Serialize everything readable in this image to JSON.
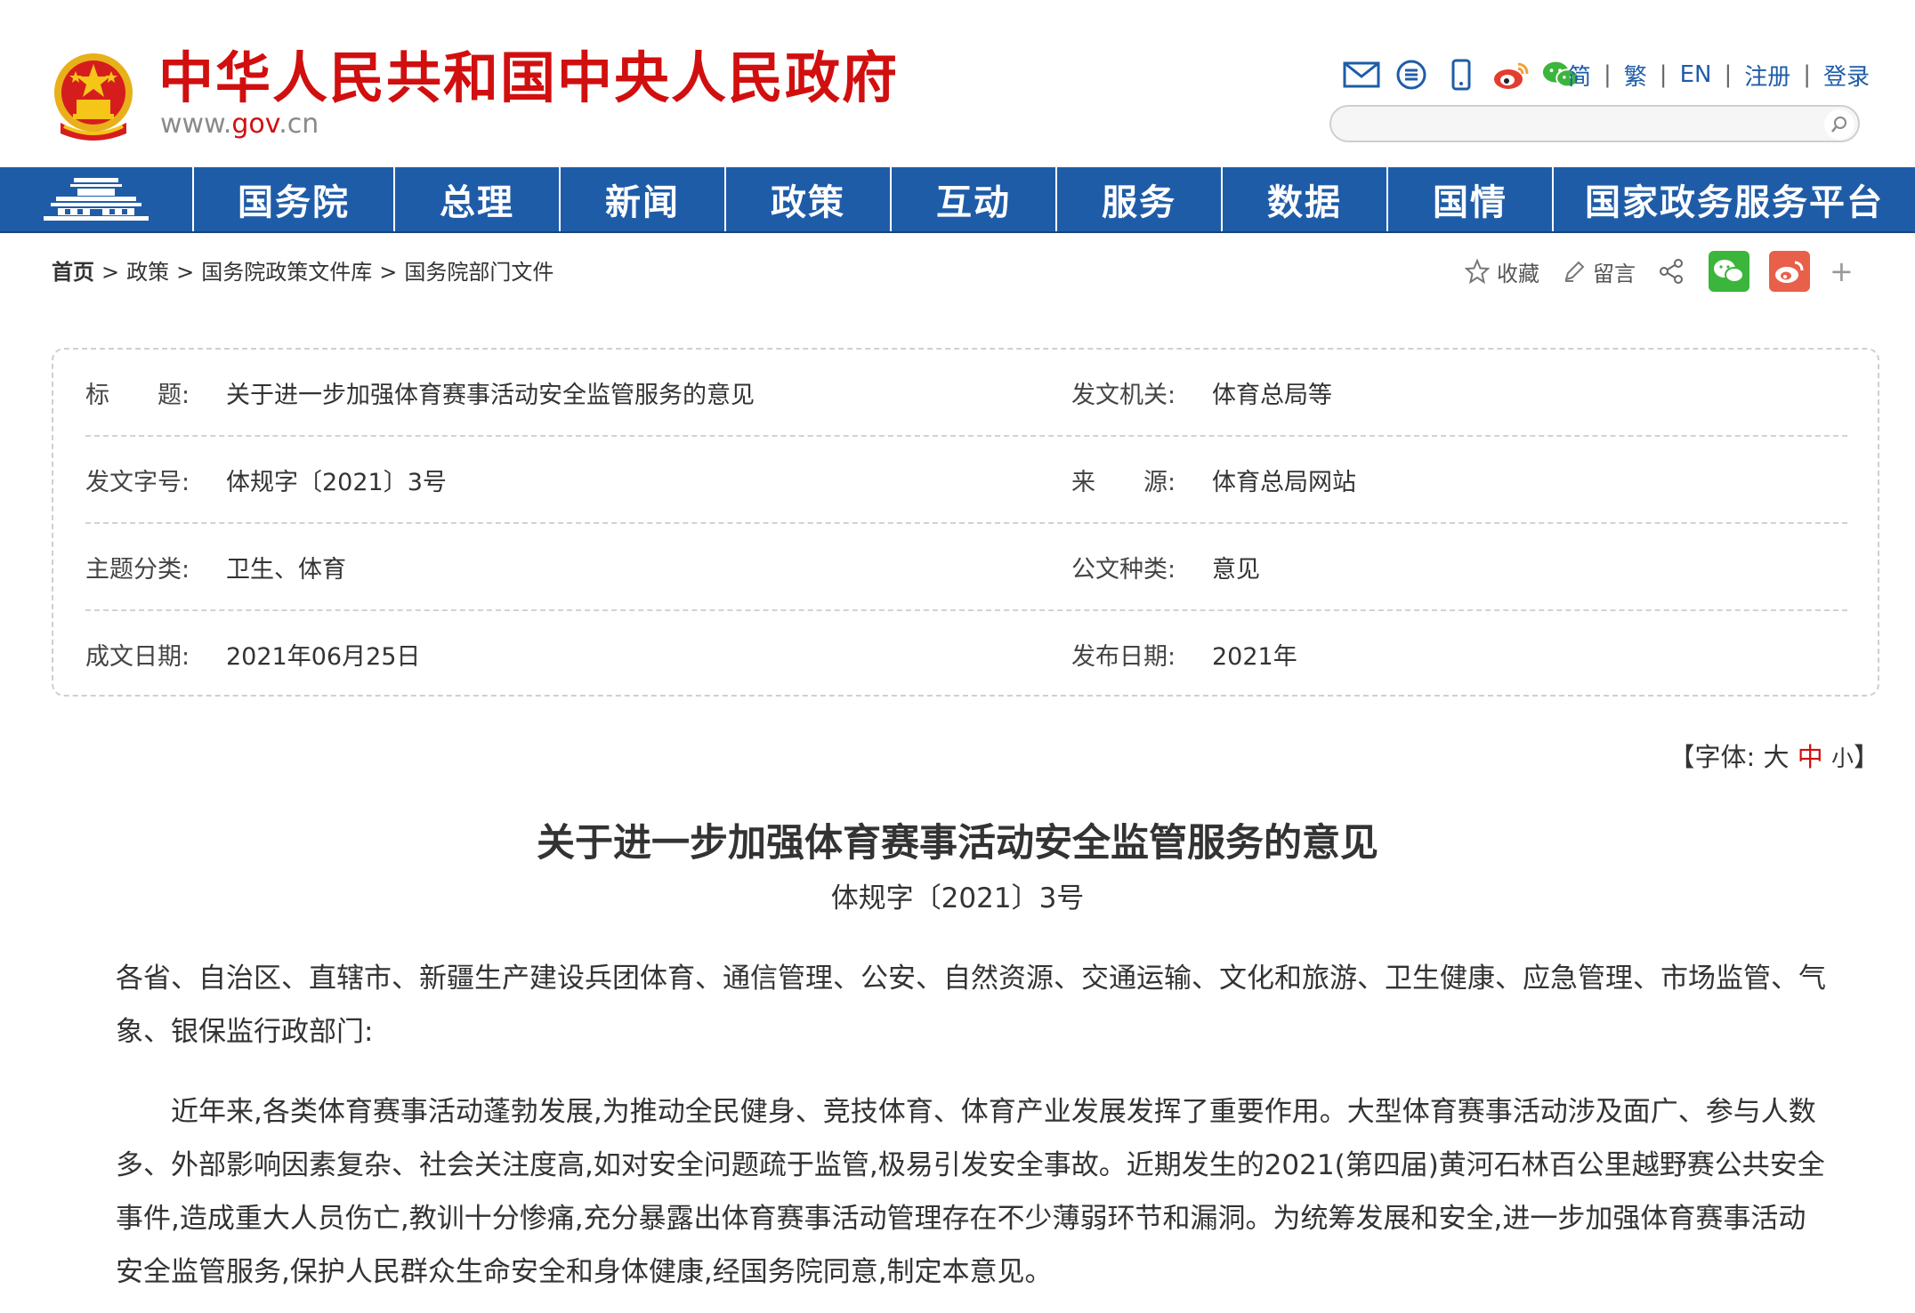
{
  "header": {
    "site_title": "中华人民共和国中央人民政府",
    "site_url_prefix": "www.",
    "site_url_accent": "gov",
    "site_url_suffix": ".cn",
    "icons": [
      "mail-icon",
      "rss-icon",
      "mobile-icon",
      "weibo-icon",
      "wechat-icon"
    ],
    "lang": {
      "simplified": "简",
      "traditional": "繁",
      "english": "EN",
      "register": "注册",
      "login": "登录"
    },
    "search_placeholder": ""
  },
  "nav": {
    "items": [
      "国务院",
      "总理",
      "新闻",
      "政策",
      "互动",
      "服务",
      "数据",
      "国情",
      "国家政务服务平台"
    ]
  },
  "breadcrumb": {
    "items": [
      "首页",
      "政策",
      "国务院政策文件库",
      "国务院部门文件"
    ],
    "sep": ">"
  },
  "tools": {
    "favorite": "收藏",
    "comment": "留言",
    "more": "+"
  },
  "info": {
    "title_label": "标　　题:",
    "title_value": "关于进一步加强体育赛事活动安全监管服务的意见",
    "issuer_label": "发文机关:",
    "issuer_value": "体育总局等",
    "doc_no_label": "发文字号:",
    "doc_no_value": "体规字〔2021〕3号",
    "source_label": "来　　源:",
    "source_value": "体育总局网站",
    "topic_label": "主题分类:",
    "topic_value": "卫生、体育",
    "type_label": "公文种类:",
    "type_value": "意见",
    "written_label": "成文日期:",
    "written_value": "2021年06月25日",
    "published_label": "发布日期:",
    "published_value": "2021年"
  },
  "font_size": {
    "open": "【字体:",
    "large": "大",
    "medium": "中",
    "small": "小",
    "close": "】"
  },
  "article": {
    "title": "关于进一步加强体育赛事活动安全监管服务的意见",
    "doc_number": "体规字〔2021〕3号",
    "salutation": "各省、自治区、直辖市、新疆生产建设兵团体育、通信管理、公安、自然资源、交通运输、文化和旅游、卫生健康、应急管理、市场监管、气象、银保监行政部门:",
    "paragraph1": "近年来,各类体育赛事活动蓬勃发展,为推动全民健身、竞技体育、体育产业发展发挥了重要作用。大型体育赛事活动涉及面广、参与人数多、外部影响因素复杂、社会关注度高,如对安全问题疏于监管,极易引发安全事故。近期发生的2021(第四届)黄河石林百公里越野赛公共安全事件,造成重大人员伤亡,教训十分惨痛,充分暴露出体育赛事活动管理存在不少薄弱环节和漏洞。为统筹发展和安全,进一步加强体育赛事活动安全监管服务,保护人民群众生命安全和身体健康,经国务院同意,制定本意见。"
  },
  "colors": {
    "brand_red": "#d10f0f",
    "nav_blue": "#1f5ca8",
    "wechat_green": "#3bb53b",
    "weibo_red": "#e8604a"
  }
}
